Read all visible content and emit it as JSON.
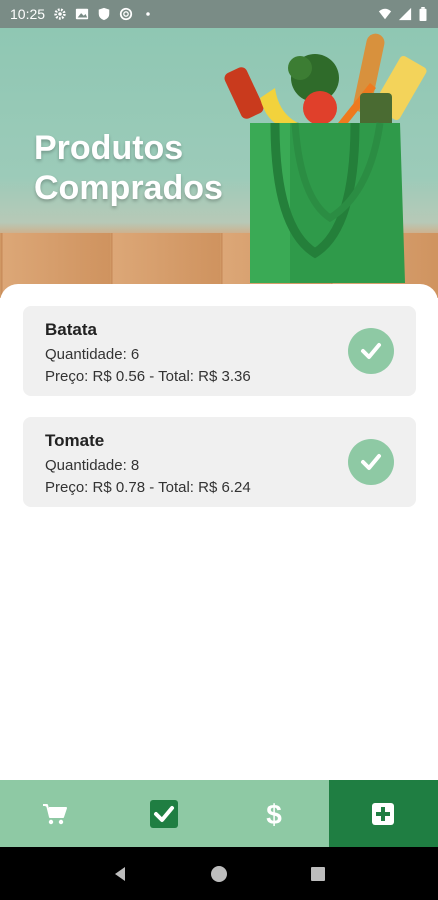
{
  "status_bar": {
    "time": "10:25",
    "icons": [
      "gear-icon",
      "image-icon",
      "shield-icon",
      "sync-icon",
      "dot-icon"
    ],
    "right_icons": [
      "wifi-icon",
      "signal-icon",
      "battery-icon"
    ]
  },
  "header": {
    "title": "Produtos Comprados"
  },
  "products": [
    {
      "name": "Batata",
      "quantity": "Quantidade: 6",
      "price": "Preço: R$ 0.56 - Total: R$ 3.36"
    },
    {
      "name": "Tomate",
      "quantity": "Quantidade: 8",
      "price": "Preço: R$ 0.78 - Total: R$ 6.24"
    }
  ],
  "bottom_nav": {
    "items": [
      "cart-icon",
      "checked-list-icon",
      "dollar-icon",
      "add-icon"
    ],
    "active_index": 3
  },
  "colors": {
    "accent_green": "#8ec9a4",
    "dark_green": "#1f7e42",
    "card_bg": "#f0f0f0"
  }
}
